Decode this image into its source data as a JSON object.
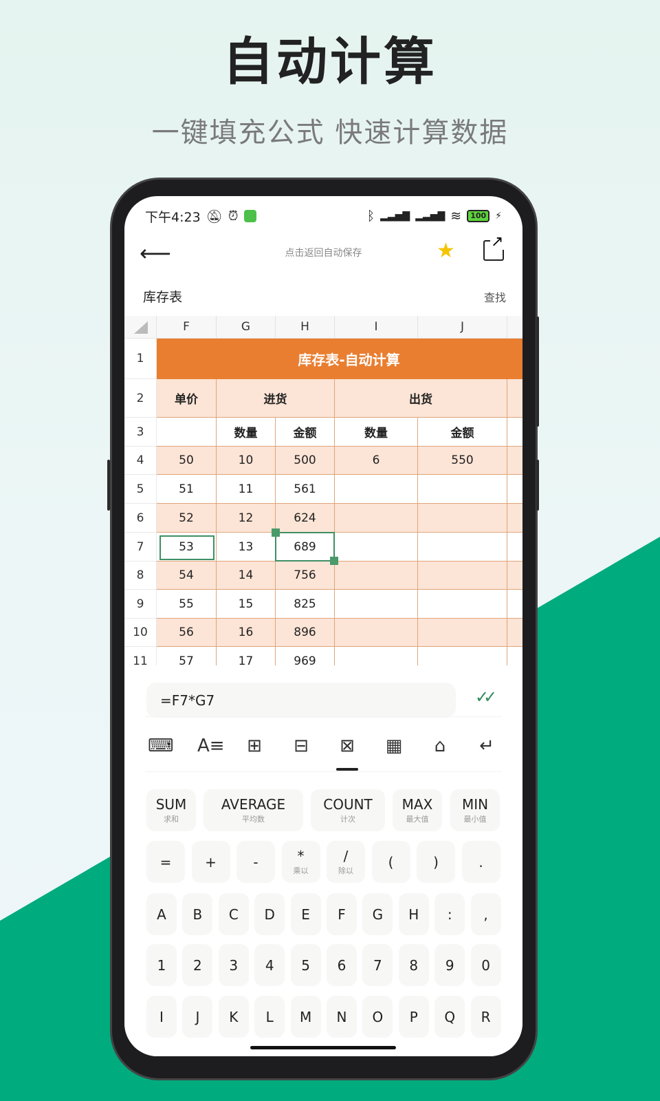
{
  "headline": {
    "title": "自动计算",
    "subtitle": "一键填充公式 快速计算数据"
  },
  "colors": {
    "accent_green": "#00ab7e",
    "sheet_orange": "#e97e31",
    "sheet_peach": "#fce4d6",
    "selection": "#3e8f64"
  },
  "status_bar": {
    "time": "下午4:23",
    "battery": "100",
    "icons": [
      "mute-bell-icon",
      "alarm-icon",
      "app-icon",
      "bluetooth-icon",
      "signal-icon",
      "hd-signal-icon",
      "wifi-icon",
      "battery-icon",
      "charging-icon"
    ]
  },
  "app_bar": {
    "back_icon": "arrow-left-icon",
    "hint": "点击返回自动保存",
    "favorite_icon": "star-icon",
    "share_icon": "share-icon"
  },
  "sheet": {
    "name": "库存表",
    "find_label": "查找",
    "columns": [
      "F",
      "G",
      "H",
      "I",
      "J"
    ],
    "title": "库存表-自动计算",
    "row2": {
      "price": "单价",
      "in": "进货",
      "out": "出货"
    },
    "row3": [
      "",
      "数量",
      "金额",
      "数量",
      "金额"
    ],
    "rows": [
      {
        "n": "4",
        "cells": [
          "50",
          "10",
          "500",
          "6",
          "550"
        ]
      },
      {
        "n": "5",
        "cells": [
          "51",
          "11",
          "561",
          "",
          ""
        ]
      },
      {
        "n": "6",
        "cells": [
          "52",
          "12",
          "624",
          "",
          ""
        ]
      },
      {
        "n": "7",
        "cells": [
          "53",
          "13",
          "689",
          "",
          ""
        ]
      },
      {
        "n": "8",
        "cells": [
          "54",
          "14",
          "756",
          "",
          ""
        ]
      },
      {
        "n": "9",
        "cells": [
          "55",
          "15",
          "825",
          "",
          ""
        ]
      },
      {
        "n": "10",
        "cells": [
          "56",
          "16",
          "896",
          "",
          ""
        ]
      },
      {
        "n": "11",
        "cells": [
          "57",
          "17",
          "969",
          "",
          ""
        ]
      }
    ],
    "row_numbers": [
      "1",
      "2",
      "3"
    ]
  },
  "formula_bar": {
    "value": "=F7*G7",
    "confirm_icon": "double-check-icon"
  },
  "toolbar": [
    "keyboard-icon",
    "text-format-icon",
    "border-icon",
    "layout-icon",
    "formula-icon",
    "grid-icon",
    "clear-icon",
    "enter-icon"
  ],
  "functions": [
    {
      "label": "SUM",
      "sub": "求和"
    },
    {
      "label": "AVERAGE",
      "sub": "平均数"
    },
    {
      "label": "COUNT",
      "sub": "计次"
    },
    {
      "label": "MAX",
      "sub": "最大值"
    },
    {
      "label": "MIN",
      "sub": "最小值"
    }
  ],
  "symbols": [
    {
      "label": "=",
      "sub": ""
    },
    {
      "label": "+",
      "sub": ""
    },
    {
      "label": "-",
      "sub": ""
    },
    {
      "label": "*",
      "sub": "乘以"
    },
    {
      "label": "/",
      "sub": "除以"
    },
    {
      "label": "(",
      "sub": ""
    },
    {
      "label": ")",
      "sub": ""
    },
    {
      "label": ".",
      "sub": ""
    }
  ],
  "letters1": [
    "A",
    "B",
    "C",
    "D",
    "E",
    "F",
    "G",
    "H",
    ":",
    ","
  ],
  "digits": [
    "1",
    "2",
    "3",
    "4",
    "5",
    "6",
    "7",
    "8",
    "9",
    "0"
  ],
  "letters2": [
    "I",
    "J",
    "K",
    "L",
    "M",
    "N",
    "O",
    "P",
    "Q",
    "R"
  ]
}
